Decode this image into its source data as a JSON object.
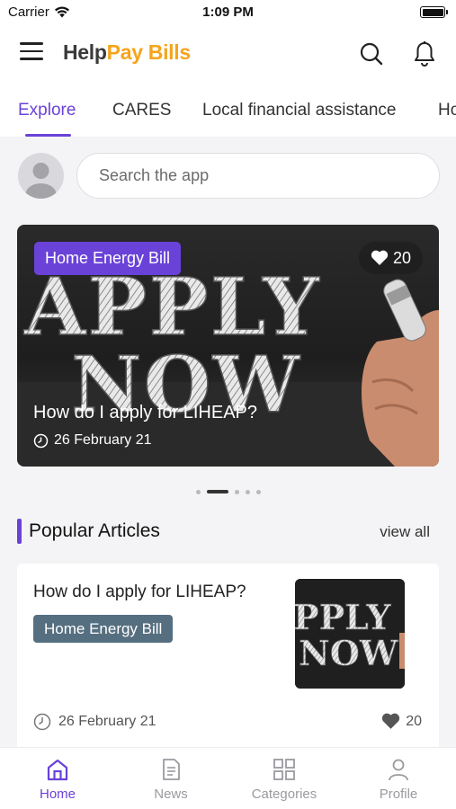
{
  "status_bar": {
    "carrier": "Carrier",
    "time": "1:09 PM"
  },
  "header": {
    "logo_part1": "Help",
    "logo_part2": "Pay",
    "logo_part3": " Bills",
    "icons": [
      "menu-icon",
      "search-icon",
      "bell-icon"
    ]
  },
  "tabs": [
    {
      "label": "Explore",
      "active": true
    },
    {
      "label": "CARES"
    },
    {
      "label": "Local financial assistance"
    },
    {
      "label": "Ho"
    }
  ],
  "search": {
    "placeholder": "Search the app"
  },
  "hero": {
    "tag": "Home Energy Bill",
    "likes": "20",
    "art_line1": "APPLY",
    "art_line2": "NOW",
    "title": "How do I apply for LIHEAP?",
    "date": "26 February 21"
  },
  "carousel": {
    "count": 5,
    "active_index": 1
  },
  "popular": {
    "title": "Popular Articles",
    "view_all": "view all",
    "articles": [
      {
        "title": "How do I apply for LIHEAP?",
        "tag": "Home Energy Bill",
        "thumb_line1": "PPLY",
        "thumb_line2": "NOW",
        "date": "26 February 21",
        "likes": "20"
      }
    ]
  },
  "bottom_nav": [
    {
      "label": "Home",
      "icon": "home-icon",
      "active": true
    },
    {
      "label": "News",
      "icon": "news-icon"
    },
    {
      "label": "Categories",
      "icon": "categories-icon"
    },
    {
      "label": "Profile",
      "icon": "profile-icon"
    }
  ],
  "colors": {
    "accent": "#6a42d8",
    "logo_orange": "#f6a41b",
    "tag_slate": "#566f80"
  }
}
